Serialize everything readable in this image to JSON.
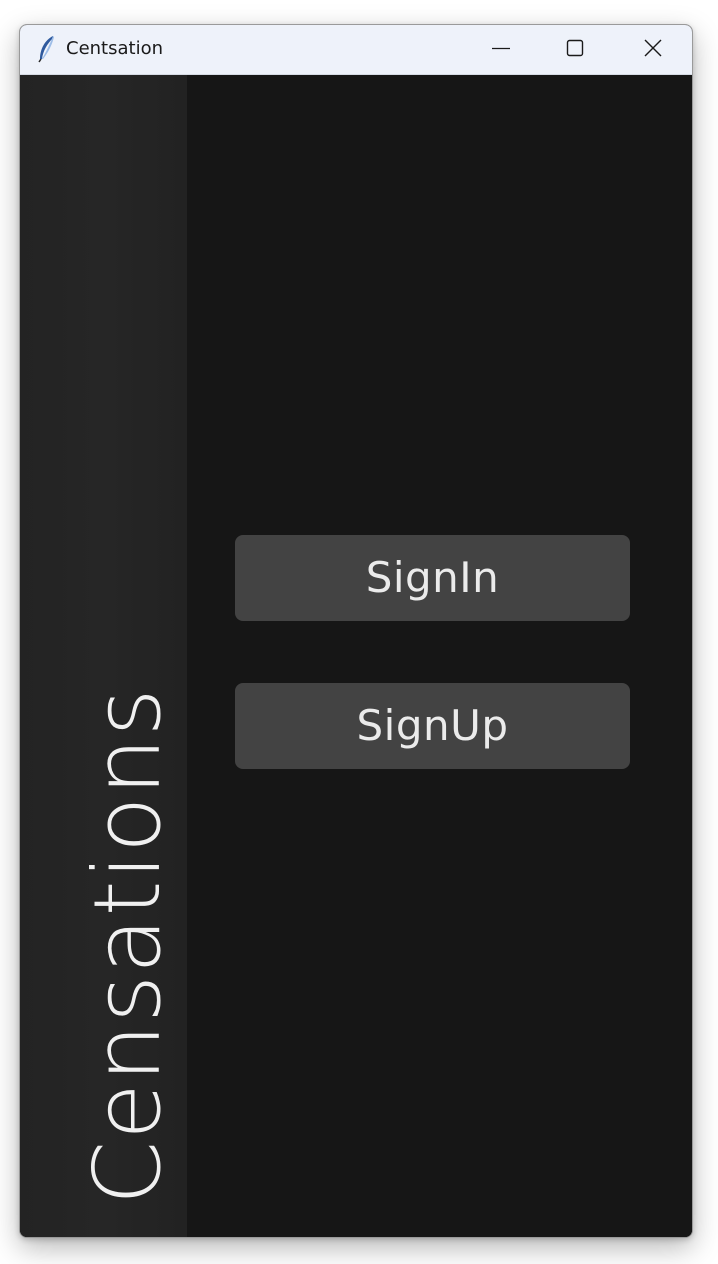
{
  "window": {
    "title": "Centsation",
    "app_icon": "feather-icon",
    "controls": {
      "minimize_icon": "minimize-icon",
      "maximize_icon": "maximize-icon",
      "close_icon": "close-icon"
    }
  },
  "sidebar": {
    "brand_text": "Censations"
  },
  "main": {
    "signin_label": "SignIn",
    "signup_label": "SignUp"
  },
  "colors": {
    "titlebar": "#eef2fa",
    "background": "#161616",
    "sidebar": "#242424",
    "button": "#434343",
    "text": "#ebebeb"
  }
}
